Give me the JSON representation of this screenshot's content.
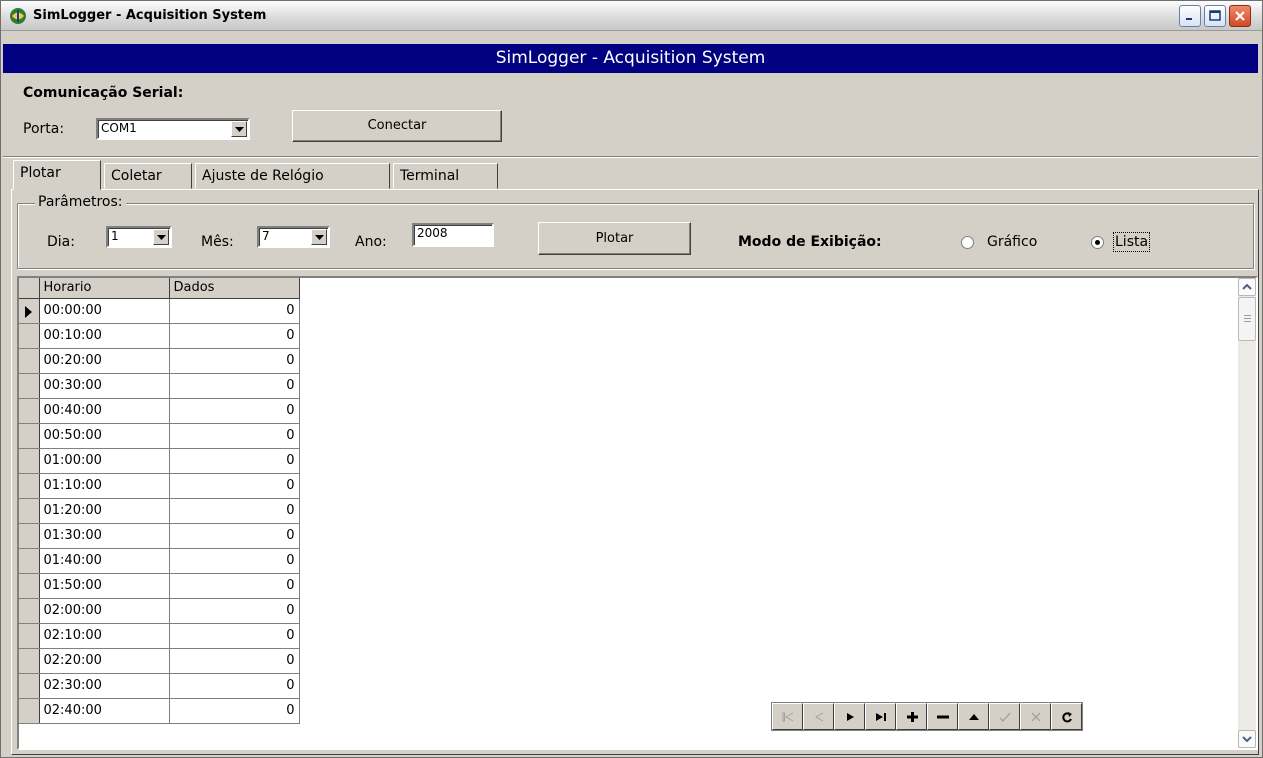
{
  "window": {
    "title": "SimLogger - Acquisition System"
  },
  "header": {
    "title": "SimLogger - Acquisition System"
  },
  "serial": {
    "section_title": "Comunicação Serial:",
    "port_label": "Porta:",
    "port_value": "COM1",
    "connect_label": "Conectar"
  },
  "tabs": [
    {
      "label": "Plotar",
      "active": true
    },
    {
      "label": "Coletar",
      "active": false
    },
    {
      "label": "Ajuste de Relógio",
      "active": false
    },
    {
      "label": "Terminal",
      "active": false
    }
  ],
  "params": {
    "legend": "Parâmetros:",
    "day_label": "Dia:",
    "day_value": "1",
    "month_label": "Mês:",
    "month_value": "7",
    "year_label": "Ano:",
    "year_value": "2008",
    "plot_button": "Plotar",
    "mode_label": "Modo de Exibição:",
    "mode_options": [
      {
        "label": "Gráfico",
        "selected": false
      },
      {
        "label": "Lista",
        "selected": true
      }
    ]
  },
  "grid": {
    "columns": [
      "Horario",
      "Dados"
    ],
    "rows": [
      [
        "00:00:00",
        "0"
      ],
      [
        "00:10:00",
        "0"
      ],
      [
        "00:20:00",
        "0"
      ],
      [
        "00:30:00",
        "0"
      ],
      [
        "00:40:00",
        "0"
      ],
      [
        "00:50:00",
        "0"
      ],
      [
        "01:00:00",
        "0"
      ],
      [
        "01:10:00",
        "0"
      ],
      [
        "01:20:00",
        "0"
      ],
      [
        "01:30:00",
        "0"
      ],
      [
        "01:40:00",
        "0"
      ],
      [
        "01:50:00",
        "0"
      ],
      [
        "02:00:00",
        "0"
      ],
      [
        "02:10:00",
        "0"
      ],
      [
        "02:20:00",
        "0"
      ],
      [
        "02:30:00",
        "0"
      ],
      [
        "02:40:00",
        "0"
      ]
    ],
    "current_row": 0
  },
  "navigator": {
    "buttons": [
      {
        "icon": "first-record-icon",
        "enabled": false
      },
      {
        "icon": "prior-record-icon",
        "enabled": false
      },
      {
        "icon": "next-record-icon",
        "enabled": true
      },
      {
        "icon": "last-record-icon",
        "enabled": true
      },
      {
        "icon": "insert-record-icon",
        "enabled": true
      },
      {
        "icon": "delete-record-icon",
        "enabled": true
      },
      {
        "icon": "edit-record-icon",
        "enabled": true
      },
      {
        "icon": "post-record-icon",
        "enabled": false
      },
      {
        "icon": "cancel-record-icon",
        "enabled": false
      },
      {
        "icon": "refresh-icon",
        "enabled": true
      }
    ]
  },
  "colors": {
    "header_band": "#000080",
    "face": "#d4d0c8",
    "disabled_glyph": "#a0a0a0"
  }
}
